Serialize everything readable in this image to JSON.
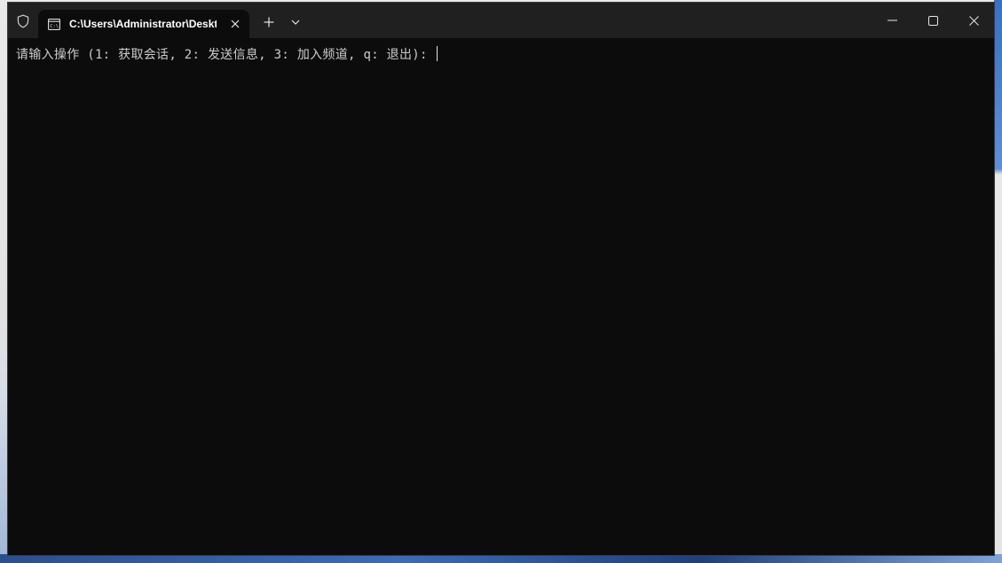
{
  "window": {
    "tab_title": "C:\\Users\\Administrator\\Deskt"
  },
  "icons": {
    "shield": "shield-icon",
    "tab": "console-icon",
    "tab_close": "close-icon",
    "new_tab": "plus-icon",
    "dropdown": "chevron-down-icon",
    "minimize": "minimize-icon",
    "maximize": "maximize-icon",
    "close": "close-icon"
  },
  "console": {
    "prompt": "请输入操作 (1: 获取会话, 2: 发送信息, 3: 加入频道, q: 退出): "
  },
  "colors": {
    "titlebar": "#202020",
    "console_bg": "#0c0c0c",
    "console_text": "#cccccc"
  }
}
